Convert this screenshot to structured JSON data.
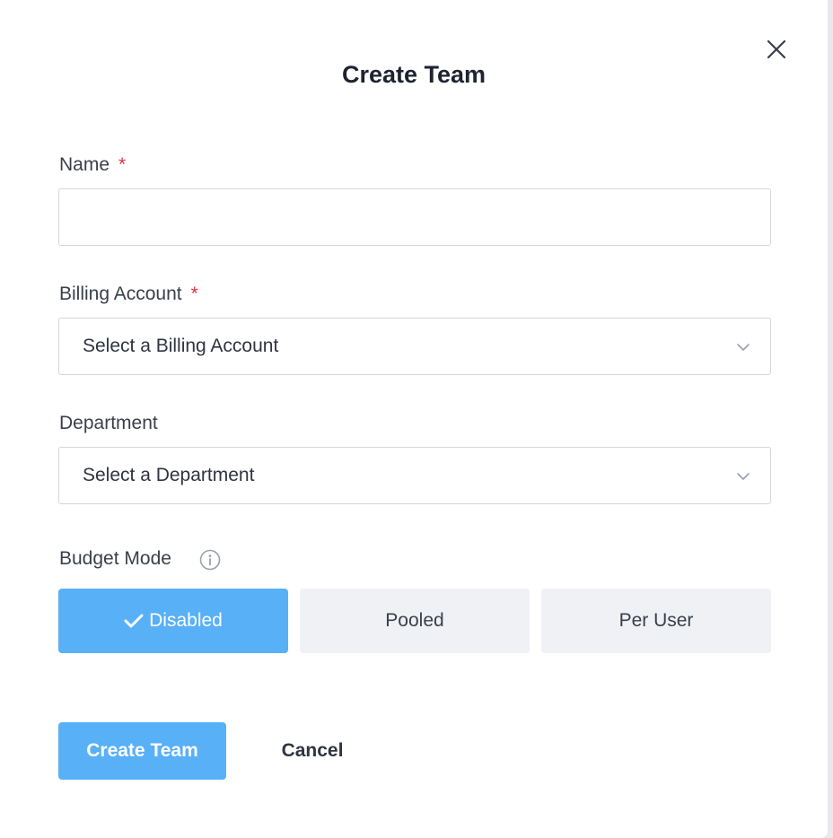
{
  "dialog": {
    "title": "Create Team",
    "close_icon": "close-icon"
  },
  "form": {
    "name": {
      "label": "Name",
      "required_marker": "*",
      "value": ""
    },
    "billing_account": {
      "label": "Billing Account",
      "required_marker": "*",
      "selected": "Select a Billing Account",
      "icon": "chevron-down-icon"
    },
    "department": {
      "label": "Department",
      "selected": "Select a Department",
      "icon": "chevron-down-icon"
    },
    "budget_mode": {
      "label": "Budget Mode",
      "info_icon": "info-icon",
      "options": [
        {
          "label": "Disabled",
          "selected": true,
          "icon": "check-icon"
        },
        {
          "label": "Pooled",
          "selected": false
        },
        {
          "label": "Per User",
          "selected": false
        }
      ]
    }
  },
  "actions": {
    "submit_label": "Create Team",
    "cancel_label": "Cancel"
  },
  "colors": {
    "primary": "#58b0f7",
    "required": "#d9363e",
    "inactive_option_bg": "#eff1f5",
    "text": "#3a3f4b"
  }
}
